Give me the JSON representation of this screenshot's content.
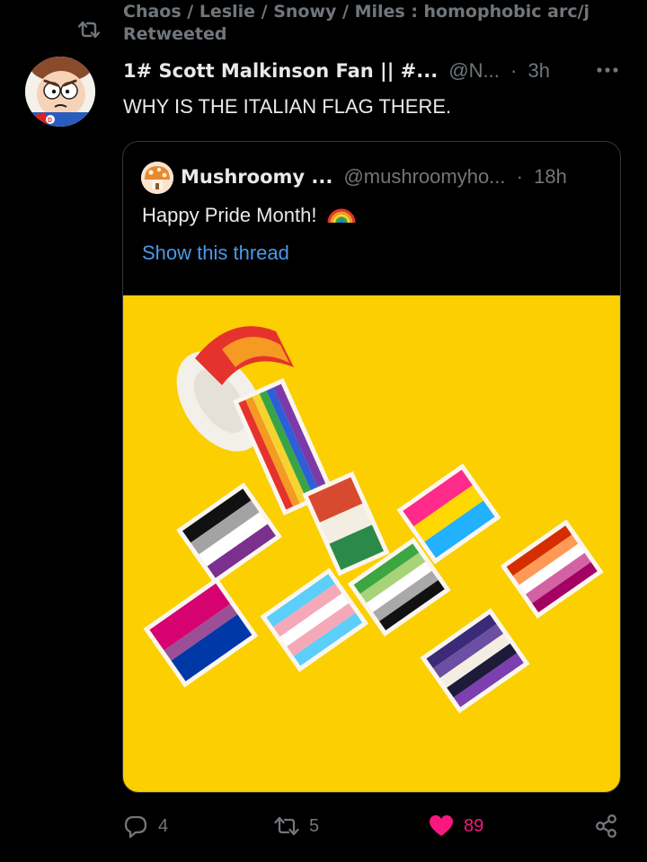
{
  "retweet_context": {
    "retweeters": "Chaos / Leslie / Snowy / Miles : homophobic arc/j",
    "label": "Retweeted"
  },
  "tweet": {
    "display_name": "1# Scott Malkinson Fan || #...",
    "handle": "@N...",
    "separator": "·",
    "time": "3h",
    "text": "WHY IS THE ITALIAN FLAG THERE."
  },
  "quoted_tweet": {
    "display_name": "Mushroomy ...",
    "handle": "@mushroomyho...",
    "separator": "·",
    "time": "18h",
    "text": "Happy Pride Month!",
    "emoji": "rainbow",
    "show_thread": "Show this thread"
  },
  "actions": {
    "replies": "4",
    "retweets": "5",
    "likes": "89"
  },
  "icons": {
    "retweet": "retweet-icon",
    "more": "more-icon",
    "reply": "reply-icon",
    "like": "heart-icon",
    "share": "share-icon"
  },
  "colors": {
    "background": "#000000",
    "text": "#e7e9ea",
    "muted": "#71767b",
    "link": "#4a99e9",
    "like": "#f91880",
    "photo_background": "#fbcf00"
  }
}
